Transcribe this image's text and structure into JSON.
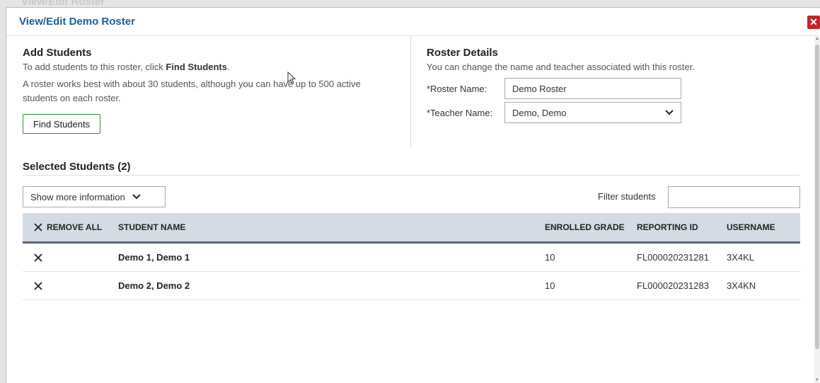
{
  "modal": {
    "title": "View/Edit Demo Roster",
    "close_label": "×"
  },
  "add_students": {
    "title": "Add Students",
    "text1_pre": "To add students to this roster, click ",
    "text1_bold": "Find Students",
    "text1_post": ".",
    "text2": "A roster works best with about 30 students, although you can have up to 500 active students on each roster.",
    "find_button": "Find Students"
  },
  "roster_details": {
    "title": "Roster Details",
    "subtitle": "You can change the name and teacher associated with this roster.",
    "name_label": "*Roster Name:",
    "name_value": "Demo Roster",
    "teacher_label": "*Teacher Name:",
    "teacher_value": "Demo, Demo"
  },
  "selected": {
    "title": "Selected Students (2)",
    "more_info": "Show more information",
    "filter_label": "Filter students",
    "filter_value": ""
  },
  "table": {
    "headers": {
      "remove_all": "REMOVE ALL",
      "student_name": "STUDENT NAME",
      "enrolled_grade": "ENROLLED GRADE",
      "reporting_id": "REPORTING ID",
      "username": "USERNAME"
    },
    "rows": [
      {
        "name": "Demo 1, Demo 1",
        "grade": "10",
        "reporting_id": "FL000020231281",
        "username": "3X4KL"
      },
      {
        "name": "Demo 2, Demo 2",
        "grade": "10",
        "reporting_id": "FL000020231283",
        "username": "3X4KN"
      }
    ]
  },
  "icons": {
    "remove_row": "×-icon",
    "dropdown": "chevron-down-icon",
    "close": "close-icon"
  },
  "colors": {
    "title_blue": "#1f5f95",
    "close_red": "#c0262d",
    "button_green": "#2e8b2e",
    "header_bg": "#d3dce4"
  }
}
